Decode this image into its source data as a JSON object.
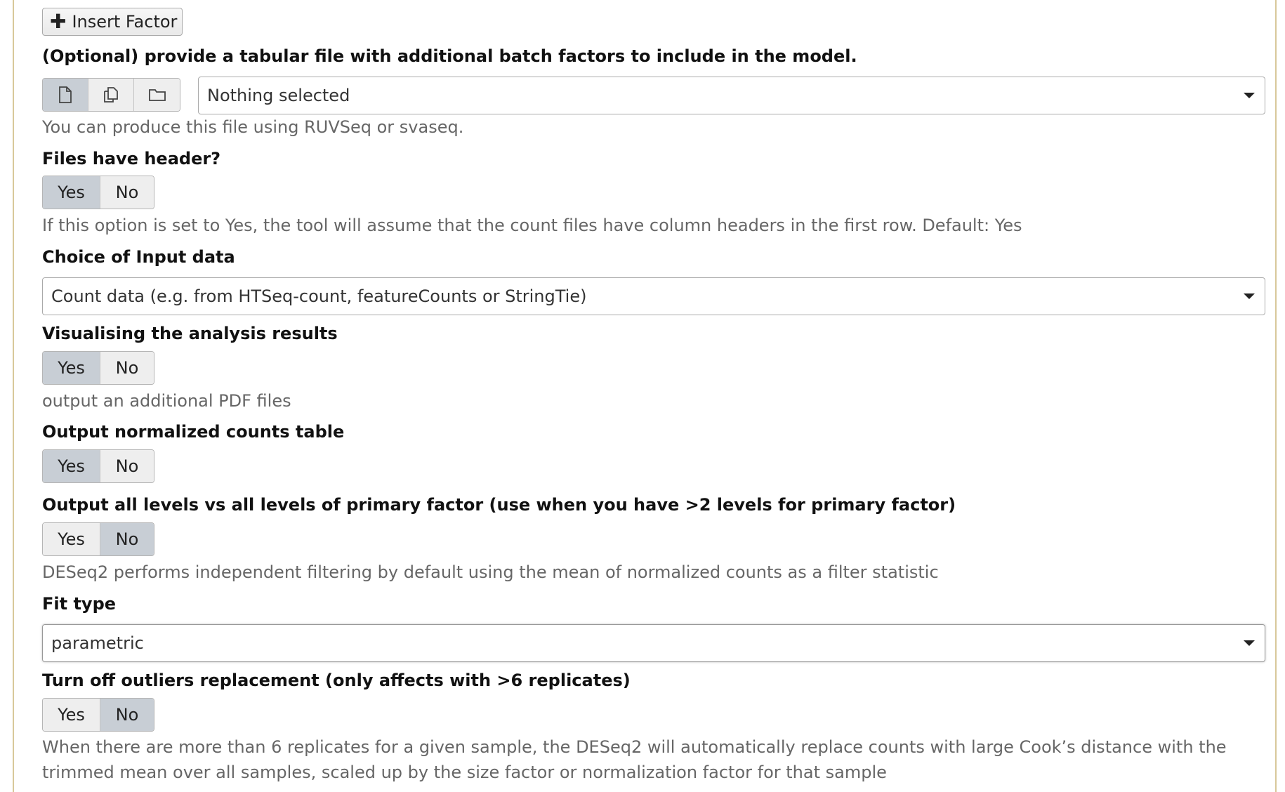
{
  "insert_factor": {
    "icon": "plus-icon",
    "label": "Insert Factor"
  },
  "batch_factors": {
    "label": "(Optional) provide a tabular file with additional batch factors to include in the model.",
    "file_modes": [
      {
        "icon": "single-file-icon",
        "active": true
      },
      {
        "icon": "multiple-files-icon",
        "active": false
      },
      {
        "icon": "folder-icon",
        "active": false
      }
    ],
    "select_value": "Nothing selected",
    "help": "You can produce this file using RUVSeq or svaseq."
  },
  "files_have_header": {
    "label": "Files have header?",
    "yes": "Yes",
    "no": "No",
    "selected": "Yes",
    "help": "If this option is set to Yes, the tool will assume that the count files have column headers in the first row. Default: Yes"
  },
  "input_data": {
    "label": "Choice of Input data",
    "select_value": "Count data (e.g. from HTSeq-count, featureCounts or StringTie)"
  },
  "visualising": {
    "label": "Visualising the analysis results",
    "yes": "Yes",
    "no": "No",
    "selected": "Yes",
    "help": "output an additional PDF files"
  },
  "normalized_counts": {
    "label": "Output normalized counts table",
    "yes": "Yes",
    "no": "No",
    "selected": "Yes"
  },
  "all_levels": {
    "label": "Output all levels vs all levels of primary factor (use when you have >2 levels for primary factor)",
    "yes": "Yes",
    "no": "No",
    "selected": "No",
    "help": "DESeq2 performs independent filtering by default using the mean of normalized counts as a filter statistic"
  },
  "fit_type": {
    "label": "Fit type",
    "select_value": "parametric"
  },
  "outliers": {
    "label": "Turn off outliers replacement (only affects with >6 replicates)",
    "yes": "Yes",
    "no": "No",
    "selected": "No",
    "help": "When there are more than 6 replicates for a given sample, the DESeq2 will automatically replace counts with large Cook’s distance with the trimmed mean over all samples, scaled up by the size factor or normalization factor for that sample"
  },
  "colors": {
    "active_toggle": "#c8ced5",
    "inactive_toggle": "#eeeeee",
    "help_text": "#666666",
    "frame_border": "#d8c89a"
  }
}
